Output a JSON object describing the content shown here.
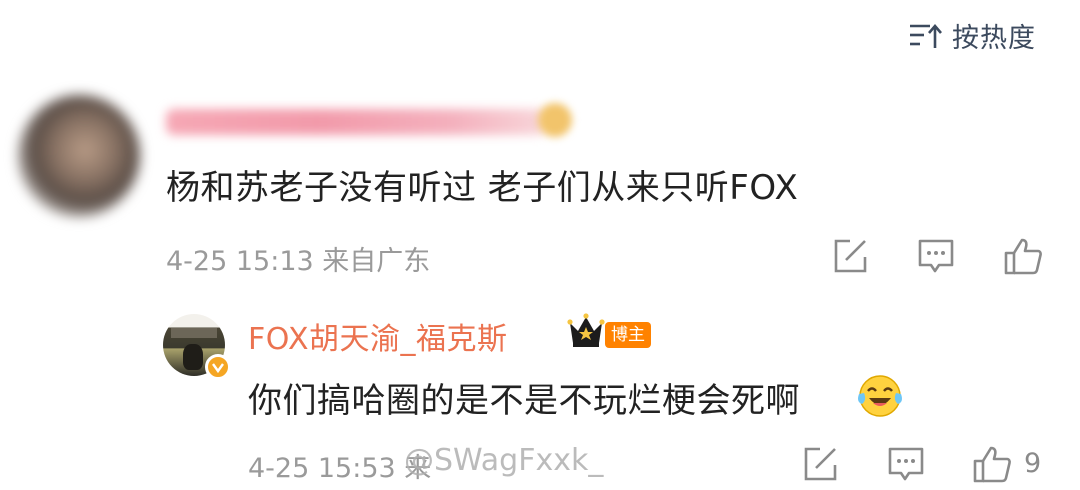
{
  "sort": {
    "icon": "sort-descending-icon",
    "label": "按热度"
  },
  "comment": {
    "text": "杨和苏老子没有听过 老子们从来只听FOX",
    "meta": "4-25 15:13 来自广东",
    "actions": [
      "share-icon",
      "comment-icon",
      "like-icon"
    ]
  },
  "reply": {
    "author": "FOX胡天渝_福克斯",
    "role_badge": "博主",
    "text": "你们搞哈圈的是不是不玩烂梗会死啊",
    "emoji": "laughing-crying-emoji",
    "meta": "4-25 15:53 来",
    "like_count": "9",
    "actions": [
      "share-icon",
      "comment-icon",
      "like-icon"
    ]
  },
  "watermark": "@SWagFxxk_",
  "colors": {
    "author": "#eb7350",
    "badge": "#ff8200",
    "meta": "#9a9a9a",
    "icon": "#8a8a8a"
  }
}
